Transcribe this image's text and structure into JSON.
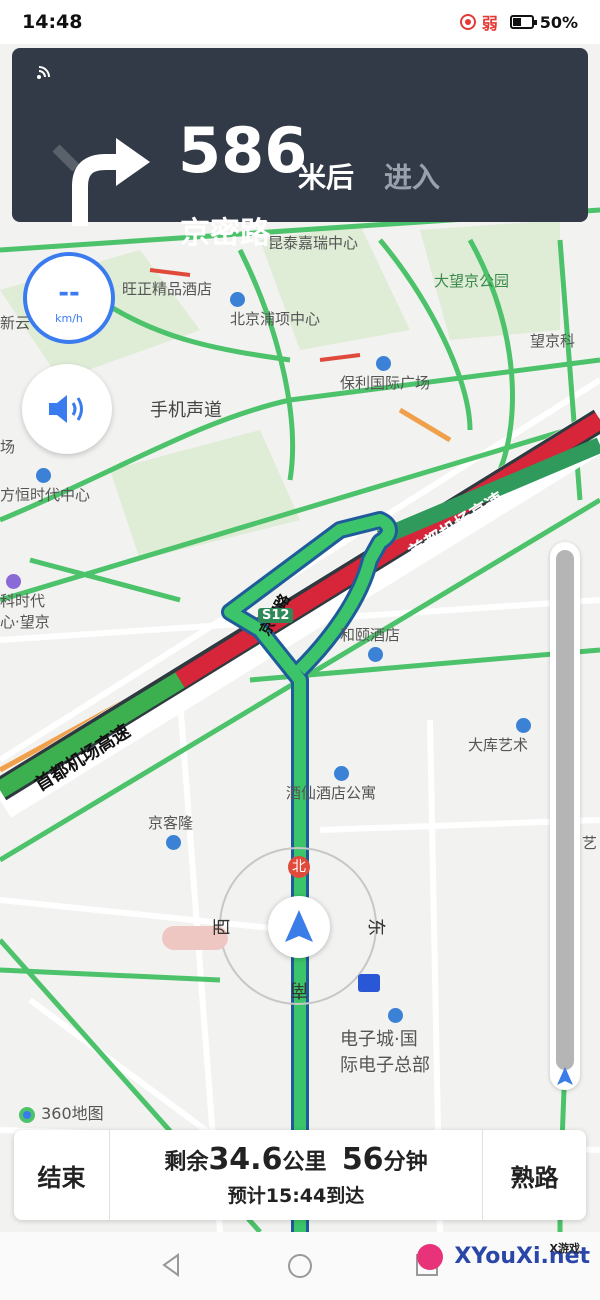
{
  "status_bar": {
    "time": "14:48",
    "signal_label": "弱",
    "battery": "50%"
  },
  "guidance": {
    "distance": "586",
    "unit": "米后",
    "action": "进入",
    "road": "京密路"
  },
  "speed": {
    "value": "--",
    "unit": "km/h"
  },
  "map": {
    "pois": [
      "昆泰嘉瑞中心",
      "旺正精品酒店",
      "北京浦项中心",
      "大望京公园",
      "望京科",
      "保利国际广场",
      "手机声道",
      "方恒时代中心",
      "科时代",
      "心·望京",
      "和颐酒店",
      "大库艺术",
      "酒仙酒店公寓",
      "京客隆",
      "电子城·国",
      "际电子总部",
      "新云",
      "场",
      "艺"
    ],
    "roads": [
      "首都机场高速",
      "京密路"
    ],
    "road_shield": "S12",
    "compass": {
      "north": "北",
      "east": "东",
      "south": "南",
      "west": "西"
    },
    "brand": "360地图"
  },
  "trip": {
    "end_label": "结束",
    "remain_prefix": "剩余",
    "remain_distance": "34.6",
    "distance_unit": "公里",
    "remain_time": "56",
    "time_unit": "分钟",
    "eta": "预计15:44到达",
    "familiar_route_label": "熟路"
  },
  "watermark": {
    "site": "XYouXi.net",
    "tag": "X游戏"
  }
}
